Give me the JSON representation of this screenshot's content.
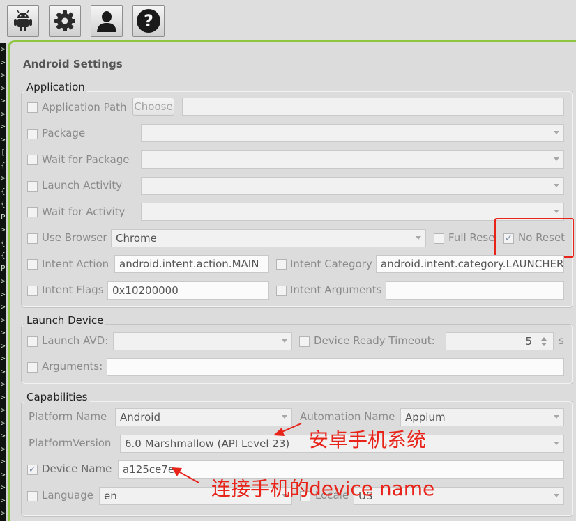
{
  "toolbar": {
    "icons": [
      "android-icon",
      "gear-icon",
      "user-icon",
      "help-icon"
    ]
  },
  "terminal_glyphs": [
    ">",
    ">",
    ">",
    ">",
    ">",
    ">",
    ">",
    ">",
    "[",
    "{",
    ">",
    "{",
    "{",
    "P",
    ">",
    "{",
    "{",
    "P",
    ">",
    ">",
    ">",
    ">",
    ">",
    ">",
    ">",
    ">",
    ">",
    ">",
    ">",
    ">",
    ">",
    ">",
    ">",
    ">",
    ">",
    ">",
    ">"
  ],
  "panel_title": "Android Settings",
  "application": {
    "label": "Application",
    "app_path": {
      "label": "Application Path",
      "choose": "Choose",
      "value": ""
    },
    "package": {
      "label": "Package",
      "value": ""
    },
    "wait_package": {
      "label": "Wait for Package",
      "value": ""
    },
    "launch_activity": {
      "label": "Launch Activity",
      "value": ""
    },
    "wait_activity": {
      "label": "Wait for Activity",
      "value": ""
    },
    "use_browser": {
      "label": "Use Browser",
      "value": "Chrome"
    },
    "full_reset": {
      "label": "Full Reset"
    },
    "no_reset": {
      "label": "No Reset",
      "check": "✓"
    },
    "intent_action": {
      "label": "Intent Action",
      "value": "android.intent.action.MAIN"
    },
    "intent_category": {
      "label": "Intent Category",
      "value": "android.intent.category.LAUNCHER"
    },
    "intent_flags": {
      "label": "Intent Flags",
      "value": "0x10200000"
    },
    "intent_args": {
      "label": "Intent Arguments",
      "value": ""
    }
  },
  "launch_device": {
    "label": "Launch Device",
    "launch_avd": {
      "label": "Launch AVD:",
      "value": ""
    },
    "ready_timeout": {
      "label": "Device Ready Timeout:",
      "value": "5",
      "unit": "s"
    },
    "arguments": {
      "label": "Arguments:",
      "value": ""
    }
  },
  "capabilities": {
    "label": "Capabilities",
    "platform_name": {
      "label": "Platform Name",
      "value": "Android"
    },
    "automation_name": {
      "label": "Automation Name",
      "value": "Appium"
    },
    "platform_version": {
      "label": "PlatformVersion",
      "value": "6.0 Marshmallow (API Level 23)"
    },
    "device_name": {
      "label": "Device Name",
      "value": "a125ce7e",
      "check": "✓"
    },
    "language": {
      "label": "Language",
      "value": "en"
    },
    "locale": {
      "label": "Locale",
      "value": "US"
    }
  },
  "annotations": {
    "os_note": "安卓手机系统",
    "device_note": "连接手机的device name",
    "color": "#e8241a"
  },
  "colors": {
    "accent": "#8ec63f"
  }
}
